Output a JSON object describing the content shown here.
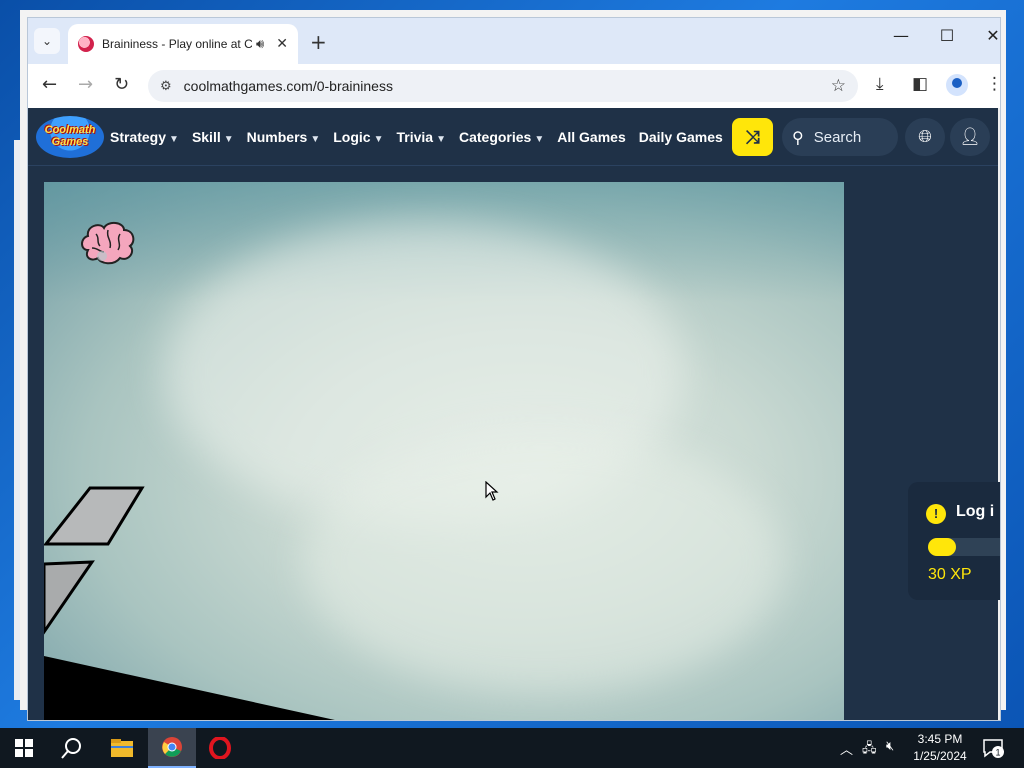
{
  "browser": {
    "tab": {
      "title": "Braininess - Play online at Coolmath Games",
      "icons": [
        "favicon-brain",
        "speaker-icon",
        "close-icon"
      ]
    },
    "new_tab_symbol": "+",
    "window_controls": {
      "minimize": "—",
      "maximize": "☐",
      "close": "✕"
    },
    "address_bar": {
      "url": "coolmathgames.com/0-braininess"
    },
    "toolbar_icons": [
      "back-icon",
      "forward-icon",
      "reload-icon",
      "site-info-icon",
      "star-icon",
      "download-icon",
      "sidepanel-icon",
      "profile-icon",
      "menu-icon"
    ]
  },
  "site": {
    "logo_text_line1": "Coolmath",
    "logo_text_line2": "Games",
    "nav": [
      {
        "label": "Strategy",
        "dropdown": true
      },
      {
        "label": "Skill",
        "dropdown": true
      },
      {
        "label": "Numbers",
        "dropdown": true
      },
      {
        "label": "Logic",
        "dropdown": true
      },
      {
        "label": "Trivia",
        "dropdown": true
      },
      {
        "label": "Categories",
        "dropdown": true
      },
      {
        "label": "All Games",
        "dropdown": false
      },
      {
        "label": "Daily Games",
        "dropdown": false
      }
    ],
    "search_label": "Search",
    "accent_color": "#ffe60a",
    "header_color": "#1f3147"
  },
  "xp_panel": {
    "alert_symbol": "!",
    "login_text": "Log i",
    "xp_label": "30 XP",
    "progress_fraction": 0.35
  },
  "taskbar": {
    "apps": [
      "windows-start-icon",
      "search-icon",
      "file-explorer-icon",
      "chrome-icon",
      "opera-icon"
    ],
    "time": "3:45 PM",
    "date": "1/25/2024",
    "notification_count": "1"
  }
}
